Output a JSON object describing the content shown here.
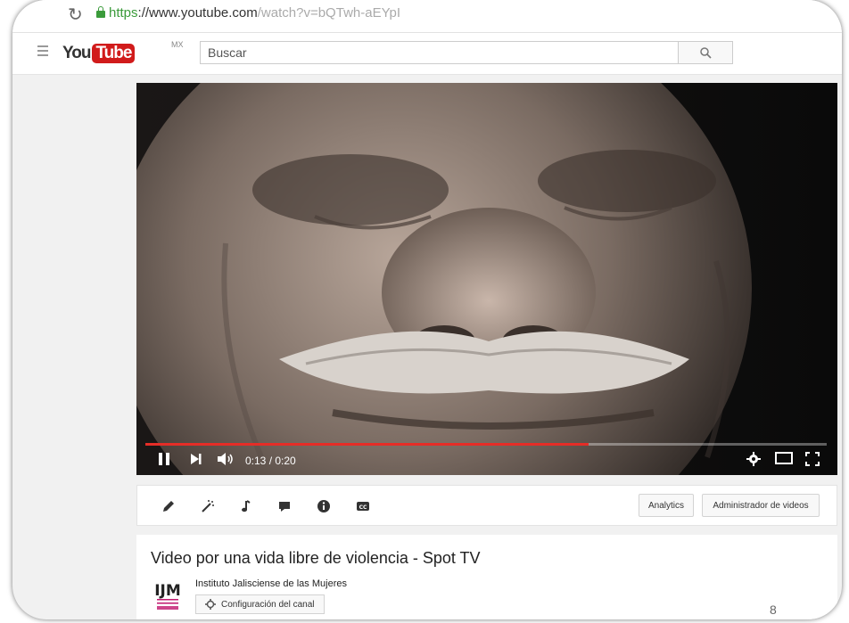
{
  "browser": {
    "url_scheme": "https",
    "url_domain": "://www.youtube.com",
    "url_path": "/watch?v=bQTwh-aEYpI"
  },
  "masthead": {
    "logo_you": "You",
    "logo_tube": "Tube",
    "region": "MX",
    "search_placeholder": "Buscar"
  },
  "player": {
    "time_display": "0:13 / 0:20",
    "progress_fraction": 0.65
  },
  "toolbar": {
    "analytics_label": "Analytics",
    "video_manager_label": "Administrador de videos"
  },
  "video": {
    "title": "Video por una vida libre de violencia - Spot TV"
  },
  "channel": {
    "name": "Instituto Jalisciense de las Mujeres",
    "logo_text": "IJM",
    "settings_label": "Configuración del canal",
    "views_partial": "8"
  },
  "colors": {
    "accent_red": "#e52d27",
    "logo_red": "#d11b1b",
    "secure_green": "#3b9b3b",
    "channel_logo_pink": "#c0166e"
  }
}
